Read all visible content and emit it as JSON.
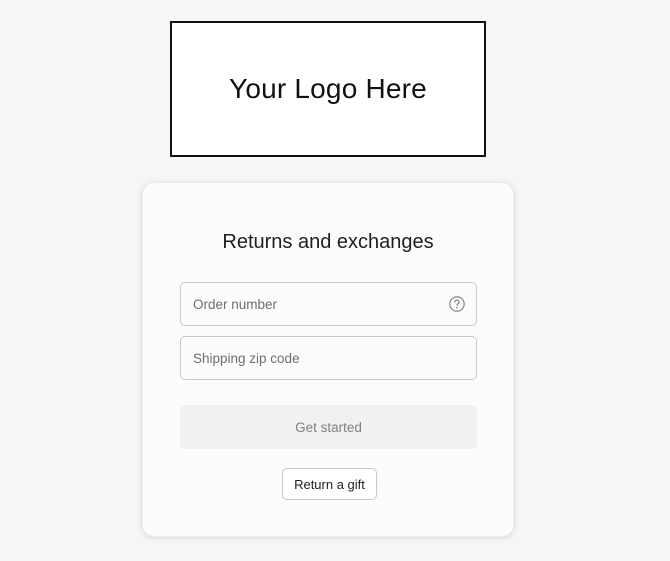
{
  "logo": {
    "text": "Your Logo Here"
  },
  "card": {
    "title": "Returns and exchanges",
    "order_number": {
      "placeholder": "Order number",
      "value": "",
      "help_icon": "question-circle-icon"
    },
    "zip_code": {
      "placeholder": "Shipping zip code",
      "value": ""
    },
    "primary_button_label": "Get started",
    "gift_button_label": "Return a gift"
  },
  "colors": {
    "page_background": "#f6f6f6",
    "card_background": "#fcfcfc",
    "primary_button_background": "#f1f1f1",
    "primary_button_text": "#808080",
    "logo_border": "#111111"
  }
}
